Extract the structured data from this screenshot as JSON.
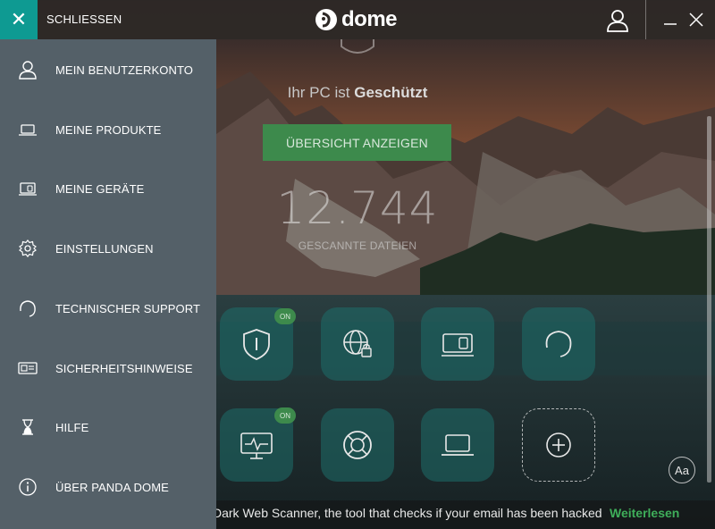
{
  "header": {
    "close_label": "SCHLIESSEN",
    "brand": "dome"
  },
  "sidebar": {
    "items": [
      {
        "label": "MEIN BENUTZERKONTO",
        "icon": "user-icon"
      },
      {
        "label": "MEINE PRODUKTE",
        "icon": "laptop-icon"
      },
      {
        "label": "MEINE GERÄTE",
        "icon": "devices-icon"
      },
      {
        "label": "EINSTELLUNGEN",
        "icon": "gear-icon"
      },
      {
        "label": "TECHNISCHER SUPPORT",
        "icon": "headset-icon"
      },
      {
        "label": "SICHERHEITSHINWEISE",
        "icon": "news-icon"
      },
      {
        "label": "HILFE",
        "icon": "hourglass-icon"
      },
      {
        "label": "ÜBER PANDA DOME",
        "icon": "info-icon"
      }
    ]
  },
  "main": {
    "status_prefix": "Ihr PC ist ",
    "status_value": "Geschützt",
    "overview_button": "ÜBERSICHT ANZEIGEN",
    "scanned_count": "12.744",
    "scanned_label": "GESCANNTE DATEIEN",
    "tiles": [
      {
        "icon": "shield-icon",
        "badge": "ON"
      },
      {
        "icon": "web-lock-icon"
      },
      {
        "icon": "usb-device-icon"
      },
      {
        "icon": "headset-icon"
      },
      {
        "icon": "monitor-pulse-icon",
        "badge": "ON"
      },
      {
        "icon": "lifebuoy-icon"
      },
      {
        "icon": "laptop-icon"
      },
      {
        "icon": "add-icon"
      }
    ],
    "font_size_button": "Aa"
  },
  "banner": {
    "text": "Dark Web Scanner, the tool that checks if your email has been hacked",
    "link": "Weiterlesen"
  },
  "colors": {
    "accent_teal": "#0e9a92",
    "sidebar_bg": "#546068",
    "green_button": "#3d8a4c",
    "link_green": "#3fae5a"
  }
}
